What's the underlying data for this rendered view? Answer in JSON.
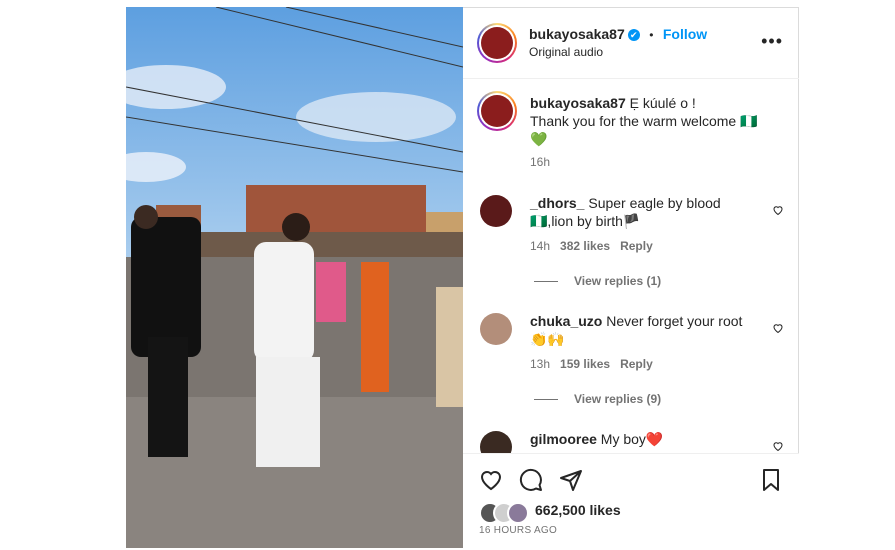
{
  "post": {
    "username": "bukayosaka87",
    "verified_badge": "✔",
    "separator": "•",
    "follow_label": "Follow",
    "audio": "Original audio",
    "more_label": "•••"
  },
  "caption": {
    "username": "bukayosaka87",
    "line1": "Ẹ kúulé o !",
    "line2": "Thank you for the warm welcome 🇳🇬",
    "line3": "💚",
    "time": "16h"
  },
  "comments": [
    {
      "username": "_dhors_",
      "text1": "Super eagle by blood",
      "text2": "🇳🇬,lion by birth🏴",
      "time": "14h",
      "likes": "382 likes",
      "reply": "Reply",
      "view_replies": "View replies (1)"
    },
    {
      "username": "chuka_uzo",
      "text1": "Never forget your root",
      "text2": "👏🙌",
      "time": "13h",
      "likes": "159 likes",
      "reply": "Reply",
      "view_replies": "View replies (9)"
    },
    {
      "username": "gilmooree",
      "text1": "My boy❤️"
    }
  ],
  "footer": {
    "likes": "662,500 likes",
    "time_ago": "16 HOURS AGO"
  },
  "colors": {
    "accent": "#0095f6",
    "text": "#262626",
    "muted": "#737373"
  }
}
